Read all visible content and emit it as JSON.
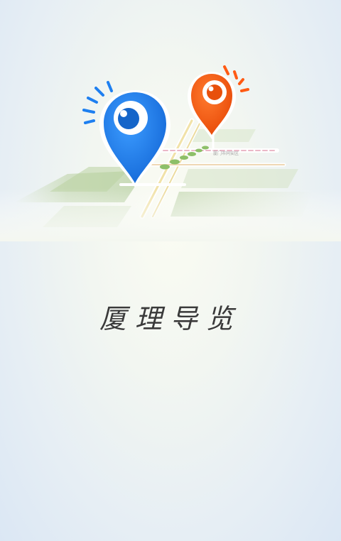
{
  "app": {
    "title": "厦理导览"
  },
  "map": {
    "road_label": "厦门市同安区"
  },
  "icons": {
    "blue_pin": "eye-location-pin-icon",
    "orange_pin": "eye-location-pin-icon"
  },
  "colors": {
    "blue_pin": "#1e7ff0",
    "orange_pin": "#ff5a13",
    "map_green": "#9cc27a",
    "road_stripe": "#eab8c7"
  }
}
